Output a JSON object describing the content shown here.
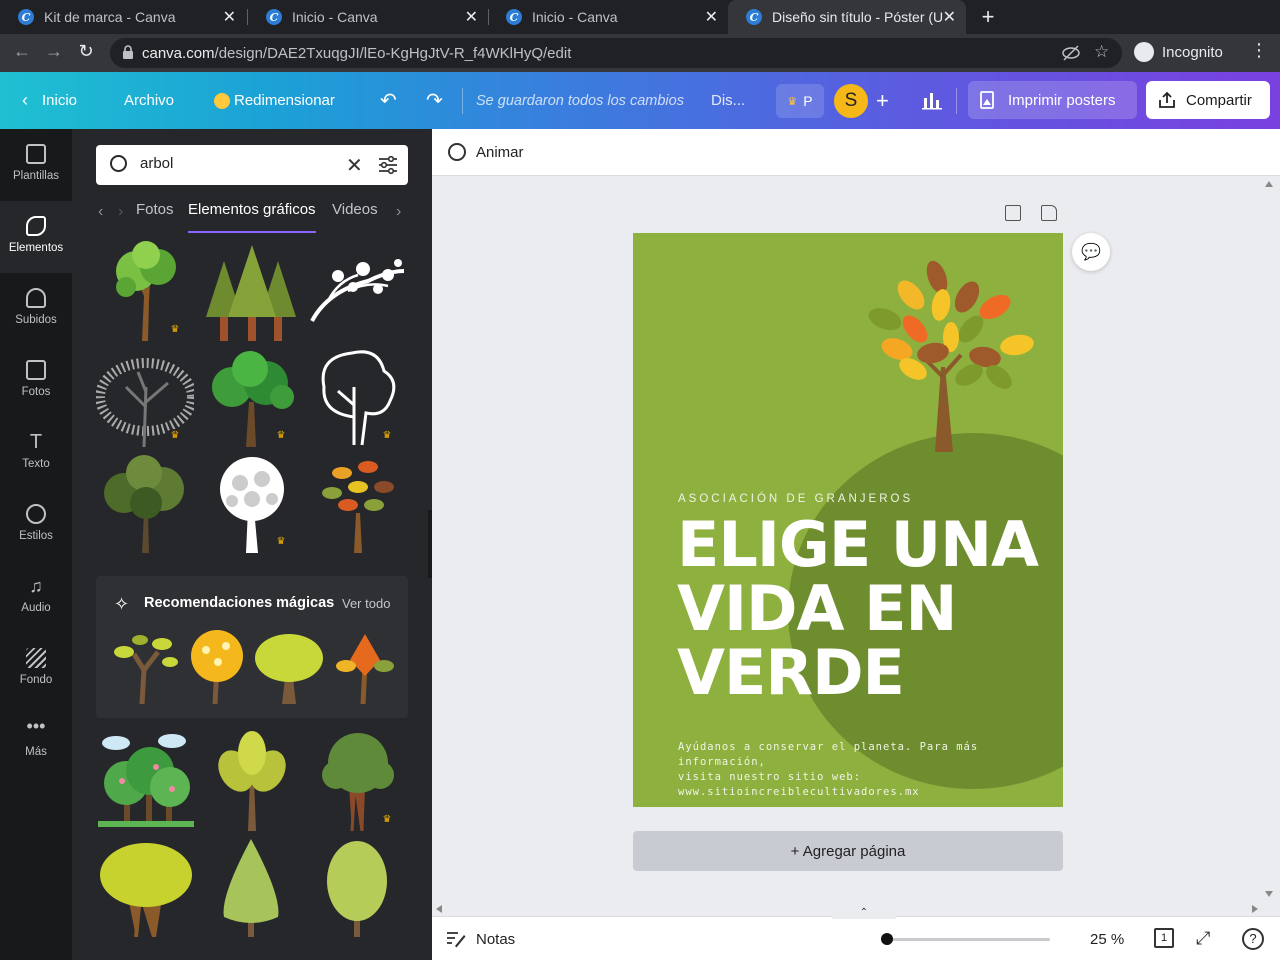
{
  "browser": {
    "tabs": [
      {
        "title": "Kit de marca - Canva"
      },
      {
        "title": "Inicio - Canva"
      },
      {
        "title": "Inicio - Canva"
      },
      {
        "title": "Diseño sin título - Póster (U"
      }
    ],
    "url_host": "canva.com",
    "url_path": "/design/DAE2TxuqgJI/lEo-KgHgJtV-R_f4WKlHyQ/edit",
    "incognito_label": "Incognito"
  },
  "topbar": {
    "home": "Inicio",
    "file": "Archivo",
    "resize": "Redimensionar",
    "saved_status": "Se guardaron todos los cambios",
    "design_name": "Dis...",
    "pro_label": "P",
    "avatar_initial": "S",
    "print": "Imprimir posters",
    "share": "Compartir"
  },
  "rail": [
    {
      "label": "Plantillas",
      "icon": "templates-icon"
    },
    {
      "label": "Elementos",
      "icon": "elements-icon"
    },
    {
      "label": "Subidos",
      "icon": "upload-icon"
    },
    {
      "label": "Fotos",
      "icon": "photos-icon"
    },
    {
      "label": "Texto",
      "icon": "text-icon"
    },
    {
      "label": "Estilos",
      "icon": "styles-icon"
    },
    {
      "label": "Audio",
      "icon": "audio-icon"
    },
    {
      "label": "Fondo",
      "icon": "background-icon"
    },
    {
      "label": "Más",
      "icon": "more-icon"
    }
  ],
  "panel": {
    "search_value": "arbol",
    "tabs": [
      "Fotos",
      "Elementos gráficos",
      "Videos"
    ],
    "magic_title": "Recomendaciones mágicas",
    "magic_link": "Ver todo"
  },
  "canvas": {
    "animate": "Animar",
    "poster": {
      "kicker": "ASOCIACIÓN DE GRANJEROS",
      "headline": [
        "ELIGE UNA",
        "VIDA EN",
        "VERDE"
      ],
      "body_line1": "Ayúdanos a conservar el planeta. Para más información,",
      "body_line2": "visita nuestro sitio web: www.sitioincreiblecultivadores.mx"
    },
    "add_page": "+ Agregar página"
  },
  "footer": {
    "notes": "Notas",
    "zoom": "25 %",
    "pages": "1",
    "zoom_level_fraction": 0.0
  },
  "colors": {
    "poster_green": "#8db03f",
    "hill_green": "#6e8d2f",
    "accent_purple": "#8b62ff",
    "gradient_start": "#1fc0d2",
    "gradient_end": "#7a40e0"
  }
}
